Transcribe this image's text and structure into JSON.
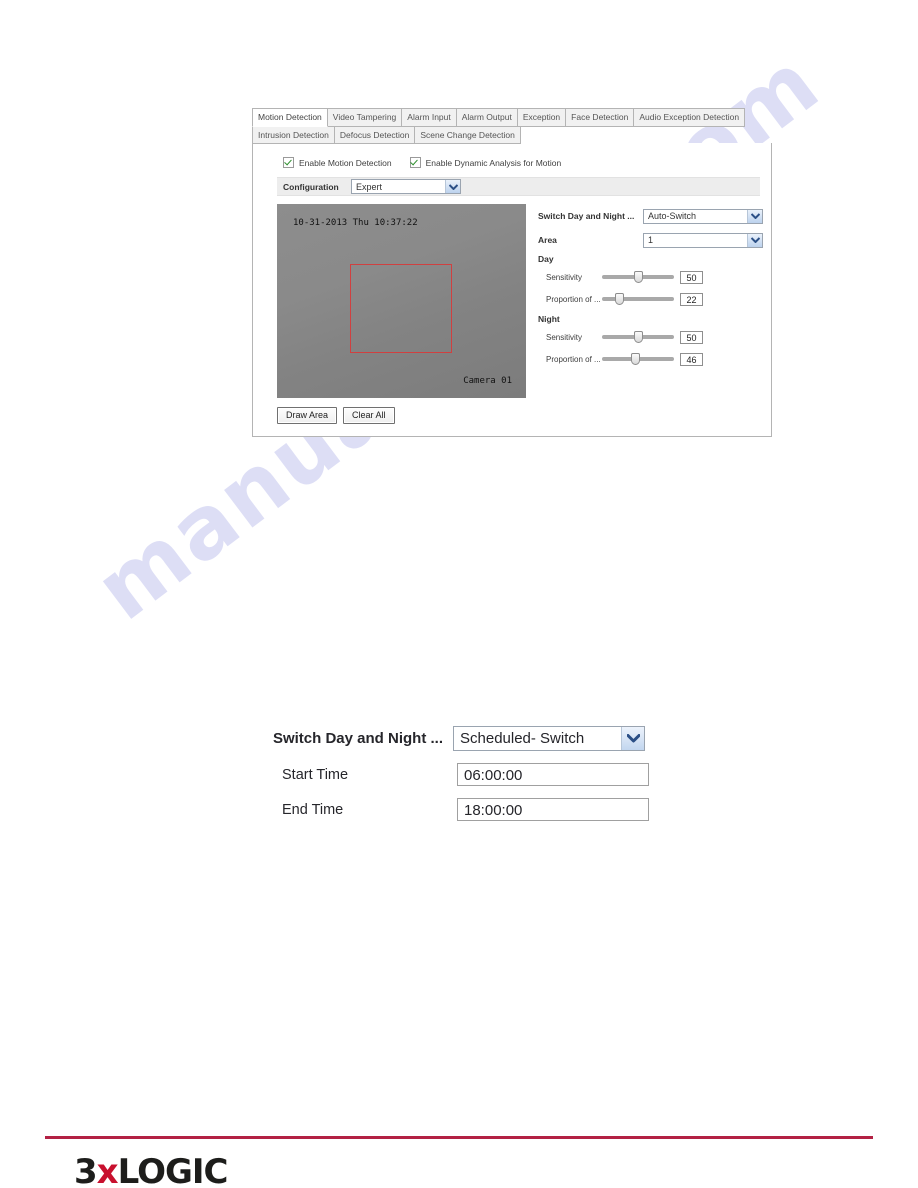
{
  "watermark": {
    "text": "manualshive.com"
  },
  "panel": {
    "tabs_row1": [
      {
        "label": "Motion Detection",
        "active": true
      },
      {
        "label": "Video Tampering",
        "active": false
      },
      {
        "label": "Alarm Input",
        "active": false
      },
      {
        "label": "Alarm Output",
        "active": false
      },
      {
        "label": "Exception",
        "active": false
      },
      {
        "label": "Face Detection",
        "active": false
      },
      {
        "label": "Audio Exception Detection",
        "active": false
      }
    ],
    "tabs_row2": [
      {
        "label": "Intrusion Detection",
        "active": false
      },
      {
        "label": "Defocus Detection",
        "active": false
      },
      {
        "label": "Scene Change Detection",
        "active": false
      }
    ],
    "checkboxes": [
      {
        "label": "Enable Motion Detection",
        "checked": true
      },
      {
        "label": "Enable Dynamic Analysis for Motion",
        "checked": true
      }
    ],
    "configuration": {
      "label": "Configuration",
      "value": "Expert"
    },
    "preview": {
      "timestamp": "10-31-2013 Thu 10:37:22",
      "camera_label": "Camera 01"
    },
    "buttons": [
      {
        "label": "Draw Area"
      },
      {
        "label": "Clear All"
      }
    ],
    "settings": {
      "switch_day_night": {
        "label": "Switch Day and Night ...",
        "value": "Auto-Switch"
      },
      "area": {
        "label": "Area",
        "value": "1"
      },
      "day": {
        "heading": "Day",
        "sensitivity": {
          "label": "Sensitivity",
          "value": "50",
          "percent": 50
        },
        "proportion": {
          "label": "Proportion of ...",
          "value": "22",
          "percent": 22
        }
      },
      "night": {
        "heading": "Night",
        "sensitivity": {
          "label": "Sensitivity",
          "value": "50",
          "percent": 50
        },
        "proportion": {
          "label": "Proportion of ...",
          "value": "46",
          "percent": 46
        }
      }
    }
  },
  "detail": {
    "switch_day_night": {
      "label": "Switch Day and Night ...",
      "value": "Scheduled- Switch"
    },
    "start_time": {
      "label": "Start Time",
      "value": "06:00:00"
    },
    "end_time": {
      "label": "End Time",
      "value": "18:00:00"
    }
  },
  "footer": {
    "logo_prefix": "3",
    "logo_accent": "x",
    "logo_suffix": "LOGIC",
    "rule_color": "#b32144"
  }
}
